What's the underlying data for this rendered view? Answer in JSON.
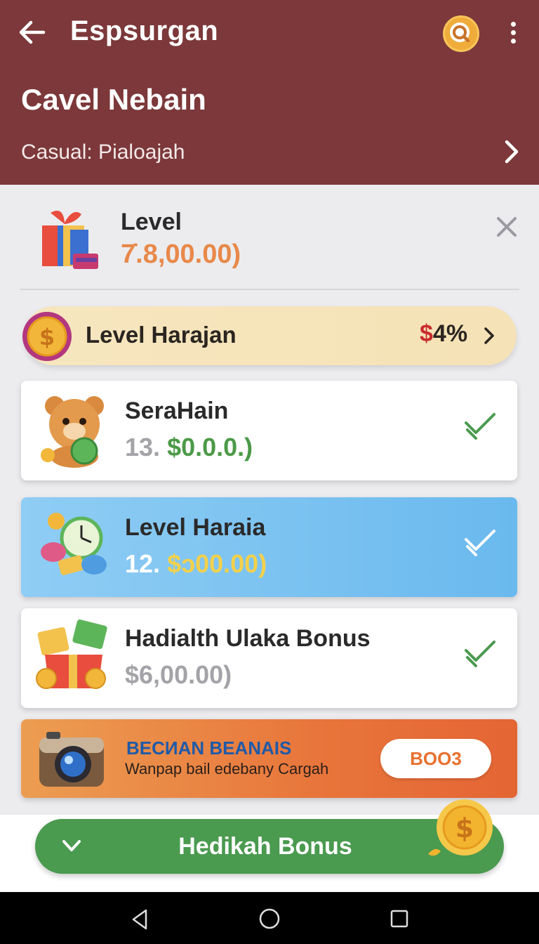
{
  "header": {
    "app_title": "Espsurgan",
    "section_title": "Cavel Nebain",
    "subtitle": "Casual: Pialoajah",
    "icons": {
      "back": "back-arrow-icon",
      "search": "search-icon",
      "menu": "more-vert-icon",
      "chevron": "chevron-right-icon"
    }
  },
  "level_card": {
    "label": "Level",
    "value": "7̇.8,00.00)",
    "icon": "gift-box-icon"
  },
  "highlight_pill": {
    "label": "Level Harajan",
    "value_symbol": "$",
    "value": "4%",
    "icon": "coin-badge-icon"
  },
  "rewards": [
    {
      "title": "SeraHain",
      "value_prefix": "13.",
      "value_hl": "$0.0.0.)",
      "value_suffix": "",
      "icon": "teddy-bear-coin-icon",
      "checked": true
    },
    {
      "title": "Level Haraia",
      "value_prefix": "12.",
      "value_hl": "$",
      "value_suffix": "ↄ00.00)",
      "icon": "clock-coins-icon",
      "checked": true
    },
    {
      "title": "Hadialth Ulaka Bonus",
      "value_prefix": "$6,00.00)",
      "value_hl": "",
      "value_suffix": "",
      "icon": "gift-coins-icon",
      "checked": true
    }
  ],
  "promo": {
    "title": "BECИAN BEANAIS",
    "description": "Wanpap bail edebany Cargah",
    "button": "BOO3",
    "icon": "camera-icon"
  },
  "cta": {
    "label": "Hedikah Bonus",
    "icon": "chevron-down-icon"
  },
  "colors": {
    "header_bg": "#7c383a",
    "accent_orange": "#e8894a",
    "green": "#4a9a4f",
    "blue_card": "#6ab9ee"
  }
}
